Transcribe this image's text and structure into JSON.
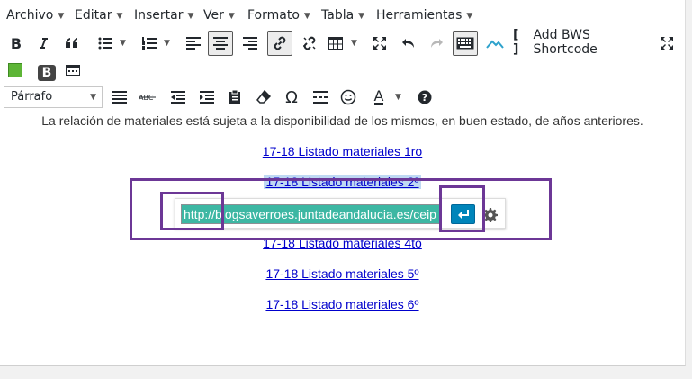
{
  "menubar": {
    "items": [
      "Archivo",
      "Editar",
      "Insertar",
      "Ver",
      "Formato",
      "Tabla",
      "Herramientas"
    ]
  },
  "toolbar": {
    "bold_label": "B",
    "shortcode_label": "Add BWS Shortcode",
    "format_value": "Párrafo",
    "b_badge_label": "B",
    "omega_label": "Ω",
    "textcolor_label": "A",
    "accent_green": "#5db536",
    "active_border": "#555555"
  },
  "content": {
    "intro": "La relación de materiales está sujeta a la disponibilidad de los mismos, en buen estado, de años anteriores.",
    "links": [
      "17-18 Listado materiales 1ro",
      "17-18 Listado materiales 2º",
      "17-18 Listado materiales 4to",
      "17-18 Listado materiales 5º",
      "17-18 Listado materiales 6º"
    ]
  },
  "link_toolbar": {
    "url_value": "http://blogsaverroes.juntadeandalucia.es/ceip",
    "input_bg": "#3db7a3",
    "apply_bg": "#0085ba"
  },
  "annotation_color": "#6c3796"
}
